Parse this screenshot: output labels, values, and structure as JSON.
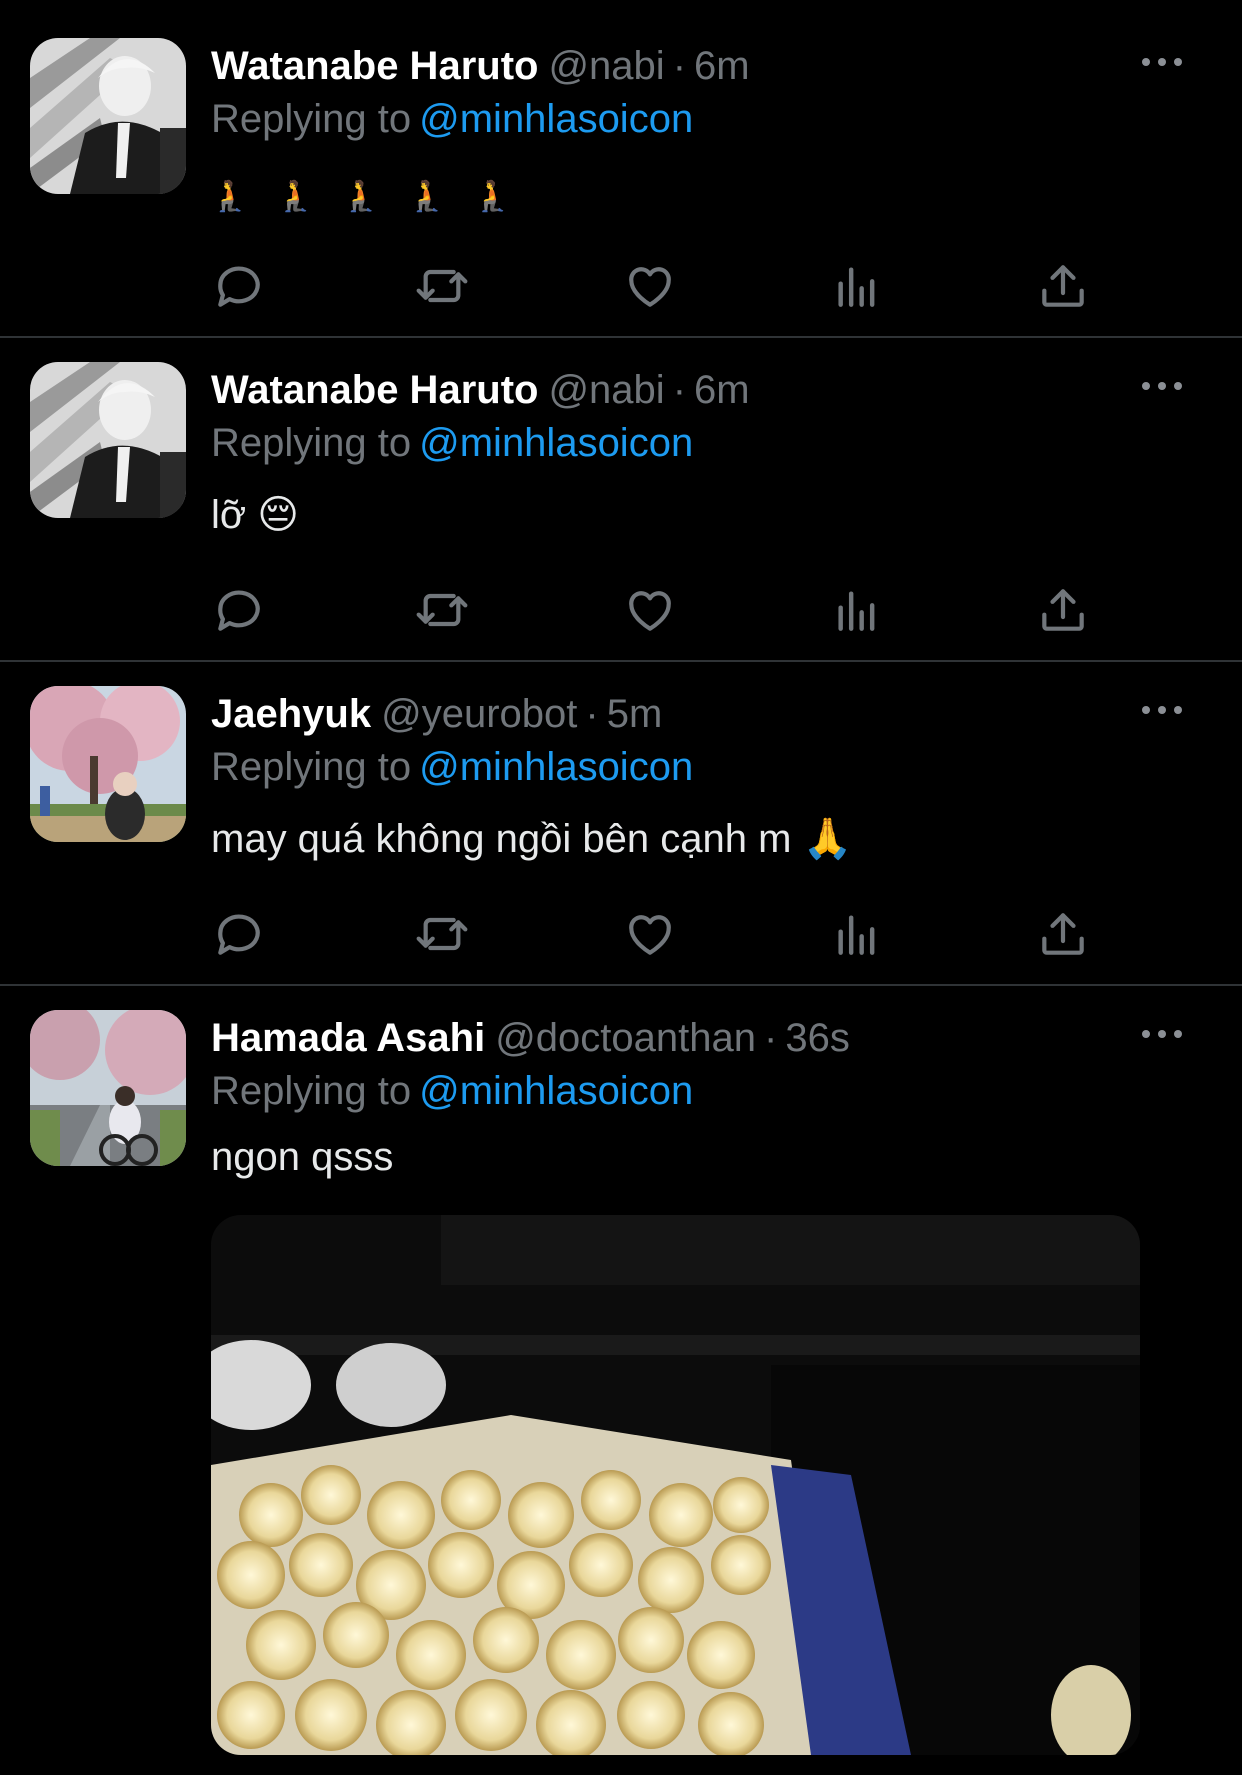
{
  "colors": {
    "background": "#000000",
    "name": "#ffffff",
    "muted": "#71767b",
    "link": "#1d9bf0",
    "divider": "#2f3336"
  },
  "tweets": [
    {
      "name": "Watanabe Haruto",
      "handle": "@nabi",
      "separator": "·",
      "time": "6m",
      "reply_prefix": "Replying to",
      "reply_mention": "@minhlasoicon",
      "text": "🧎 🧎 🧎 🧎 🧎",
      "avatar_icon": "avatar-bw-portrait-icon"
    },
    {
      "name": "Watanabe Haruto",
      "handle": "@nabi",
      "separator": "·",
      "time": "6m",
      "reply_prefix": "Replying to",
      "reply_mention": "@minhlasoicon",
      "text": "lỡ 😔",
      "avatar_icon": "avatar-bw-portrait-icon"
    },
    {
      "name": "Jaehyuk",
      "handle": "@yeurobot",
      "separator": "·",
      "time": "5m",
      "reply_prefix": "Replying to",
      "reply_mention": "@minhlasoicon",
      "text": "may quá không ngồi bên cạnh m 🙏",
      "avatar_icon": "avatar-cherry-blossom-icon"
    },
    {
      "name": "Hamada Asahi",
      "handle": "@doctoanthan",
      "separator": "·",
      "time": "36s",
      "reply_prefix": "Replying to",
      "reply_mention": "@minhlasoicon",
      "text": "ngon qsss",
      "avatar_icon": "avatar-park-road-icon",
      "media": "popcorn-photo"
    }
  ],
  "action_icons": [
    "reply-icon",
    "retweet-icon",
    "like-icon",
    "views-icon",
    "share-icon"
  ]
}
